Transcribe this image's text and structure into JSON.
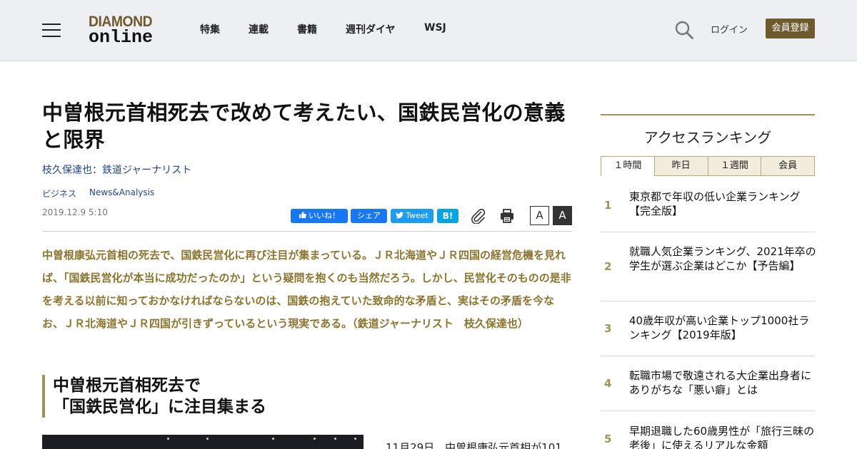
{
  "header": {
    "logo_line1": "DIAMOND",
    "logo_line2": "online",
    "nav": [
      "特集",
      "連載",
      "書籍",
      "週刊ダイヤ",
      "WSJ"
    ],
    "login_label": "ログイン",
    "register_label": "会員登録",
    "brand_color": "#6e5a2c"
  },
  "article": {
    "title": "中曽根元首相死去で改めて考えたい、国鉄民営化の意義と限界",
    "author": "枝久保達也：鉄道ジャーナリスト",
    "tags": [
      "ビジネス",
      "News&Analysis"
    ],
    "date": "2019.12.9 5:10",
    "social": {
      "like": "いいね！",
      "share": "シェア",
      "tweet": "Tweet",
      "hatena": "B!"
    },
    "font_small": "A",
    "font_large": "A",
    "lead": "中曽根康弘元首相の死去で、国鉄民営化に再び注目が集まっている。ＪＲ北海道やＪＲ四国の経営危機を見れば、「国鉄民営化が本当に成功だったのか」という疑問を抱くのも当然だろう。しかし、民営化そのものの是非を考える以前に知っておかなければならないのは、国鉄の抱えていた致命的な矛盾と、実はその矛盾を今なお、ＪＲ北海道やＪＲ四国が引きずっているという現実である。（鉄道ジャーナリスト　枝久保達也）",
    "subhead_line1": "中曽根元首相死去で",
    "subhead_line2": "「国鉄民営化」に注目集まる",
    "body_start": "11月29日、中曽根康弘元首相が101"
  },
  "sidebar": {
    "title": "アクセスランキング",
    "tabs": [
      "１時間",
      "昨日",
      "１週間",
      "会員"
    ],
    "active_tab": 0,
    "ranking": [
      {
        "rank": "1",
        "title": "東京都で年収の低い企業ランキング【完全版】"
      },
      {
        "rank": "2",
        "title": "就職人気企業ランキング、2021年卒の学生が選ぶ企業はどこか【予告編】"
      },
      {
        "rank": "3",
        "title": "40歳年収が高い企業トップ1000社ランキング【2019年版】"
      },
      {
        "rank": "4",
        "title": "転職市場で敬遠される大企業出身者にありがちな「悪い癖」とは"
      },
      {
        "rank": "5",
        "title": "早期退職した60歳男性が「旅行三昧の老後」に使えるリアルな金額"
      }
    ]
  }
}
